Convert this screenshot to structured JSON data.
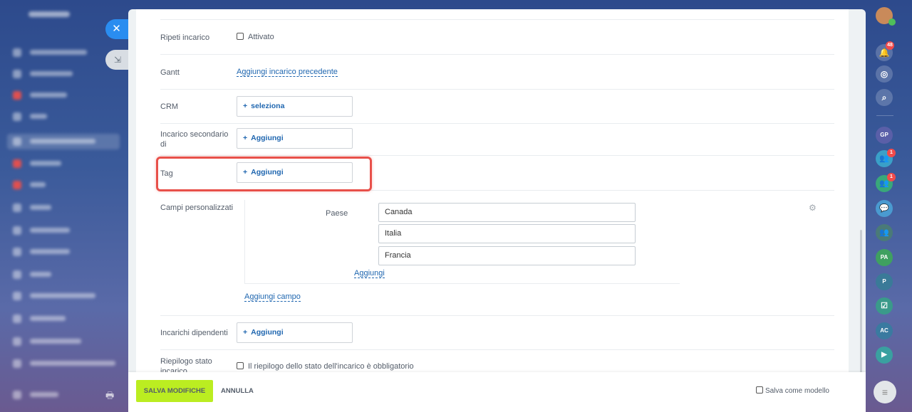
{
  "form": {
    "repeat": {
      "label": "Ripeti incarico",
      "option": "Attivato"
    },
    "gantt": {
      "label": "Gantt",
      "link": "Aggiungi incarico precedente"
    },
    "crm": {
      "label": "CRM",
      "button": "seleziona"
    },
    "subtask_of": {
      "label": "Incarico secondario di",
      "button": "Aggiungi"
    },
    "tag": {
      "label": "Tag",
      "button": "Aggiungi"
    },
    "custom_fields": {
      "label": "Campi personalizzati",
      "field_name": "Paese",
      "values": [
        "Canada",
        "Italia",
        "Francia"
      ],
      "add_value_link": "Aggiungi",
      "add_field_link": "Aggiungi campo"
    },
    "dependent": {
      "label": "Incarichi dipendenti",
      "button": "Aggiungi"
    },
    "status_summary": {
      "label": "Riepilogo stato incarico",
      "option": "Il riepilogo dello stato dell'incarico è obbligatorio"
    }
  },
  "footer": {
    "save_label": "SALVA MODIFICHE",
    "cancel_label": "ANNULLA",
    "template_label": "Salva come modello"
  },
  "right_sidebar": {
    "notification_count": "48",
    "group_badge_1": "1",
    "group_badge_2": "1",
    "avatars": [
      "GP",
      "PA",
      "P",
      "AC"
    ]
  },
  "colors": {
    "accent": "#2067b0",
    "save": "#bbed21",
    "highlight": "#e8504a",
    "badge": "#f24b4b"
  }
}
